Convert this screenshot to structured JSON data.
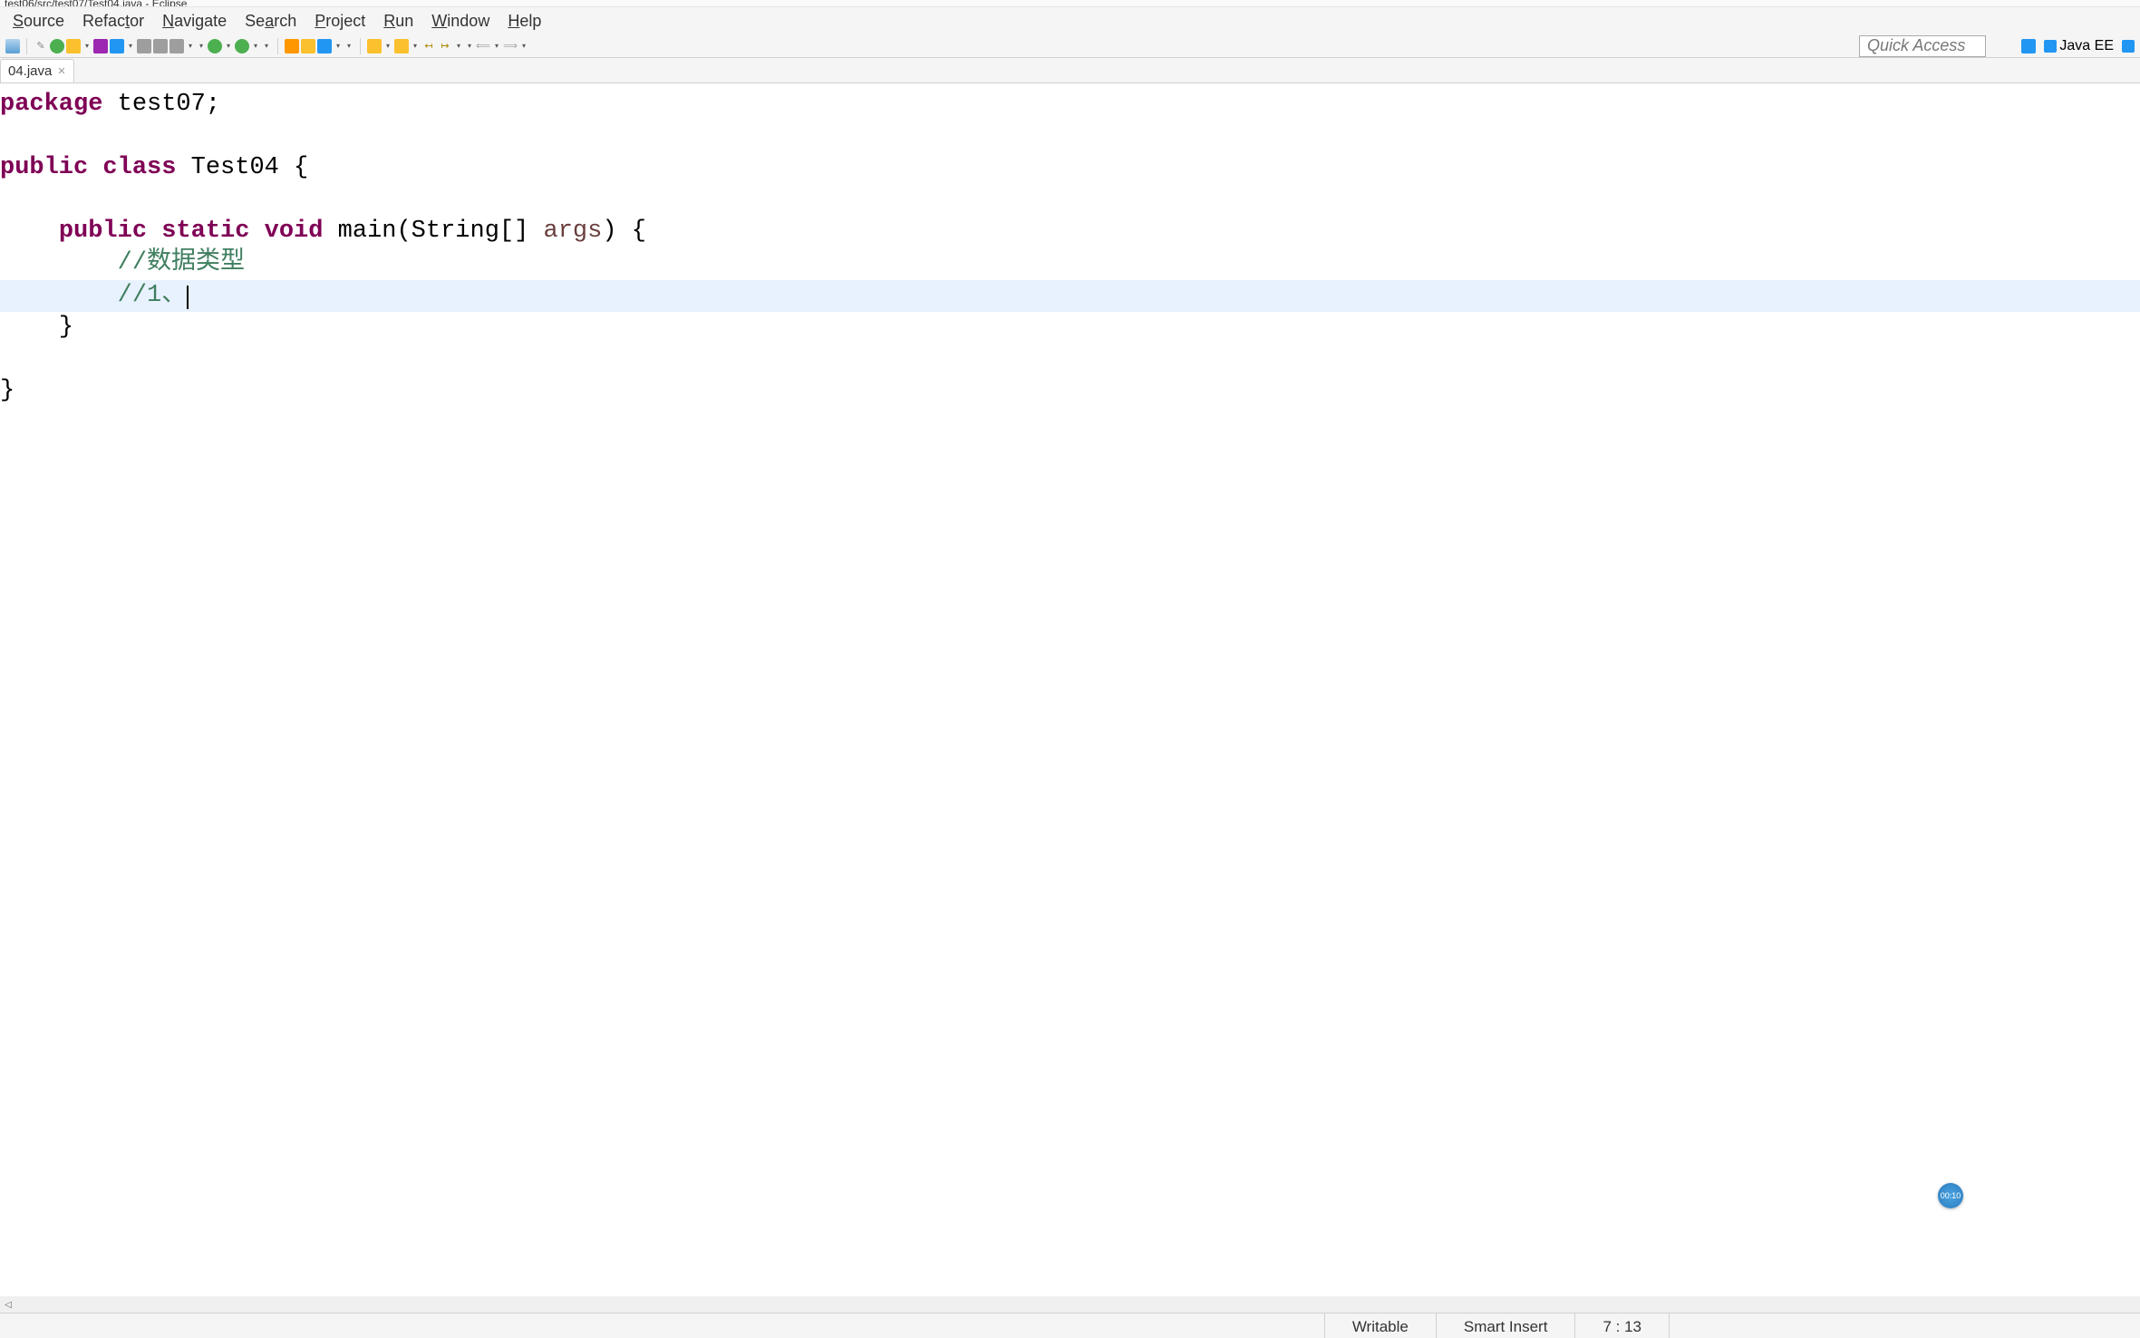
{
  "title_bar": "test06/src/test07/Test04.java - Eclipse",
  "menu": {
    "source": "Source",
    "refactor": "Refactor",
    "navigate": "Navigate",
    "search": "Search",
    "project": "Project",
    "run": "Run",
    "window": "Window",
    "help": "Help"
  },
  "quick_access_placeholder": "Quick Access",
  "perspective": {
    "java_ee": "Java EE"
  },
  "tab": {
    "name": "04.java"
  },
  "code": {
    "line1_kw": "package",
    "line1_rest": " test07;",
    "line3_kw1": "public",
    "line3_kw2": "class",
    "line3_rest": " Test04 {",
    "line5_indent": "    ",
    "line5_kw1": "public",
    "line5_kw2": "static",
    "line5_kw3": "void",
    "line5_method": " main(String[] ",
    "line5_param": "args",
    "line5_rest": ") {",
    "line6_indent": "        ",
    "line6_comment": "//数据类型",
    "line7_indent": "        ",
    "line7_comment": "//1、",
    "line8_indent": "    ",
    "line8_brace": "}",
    "line10_brace": "}"
  },
  "status": {
    "writable": "Writable",
    "insert": "Smart Insert",
    "position": "7 : 13"
  },
  "timer": "00:10"
}
